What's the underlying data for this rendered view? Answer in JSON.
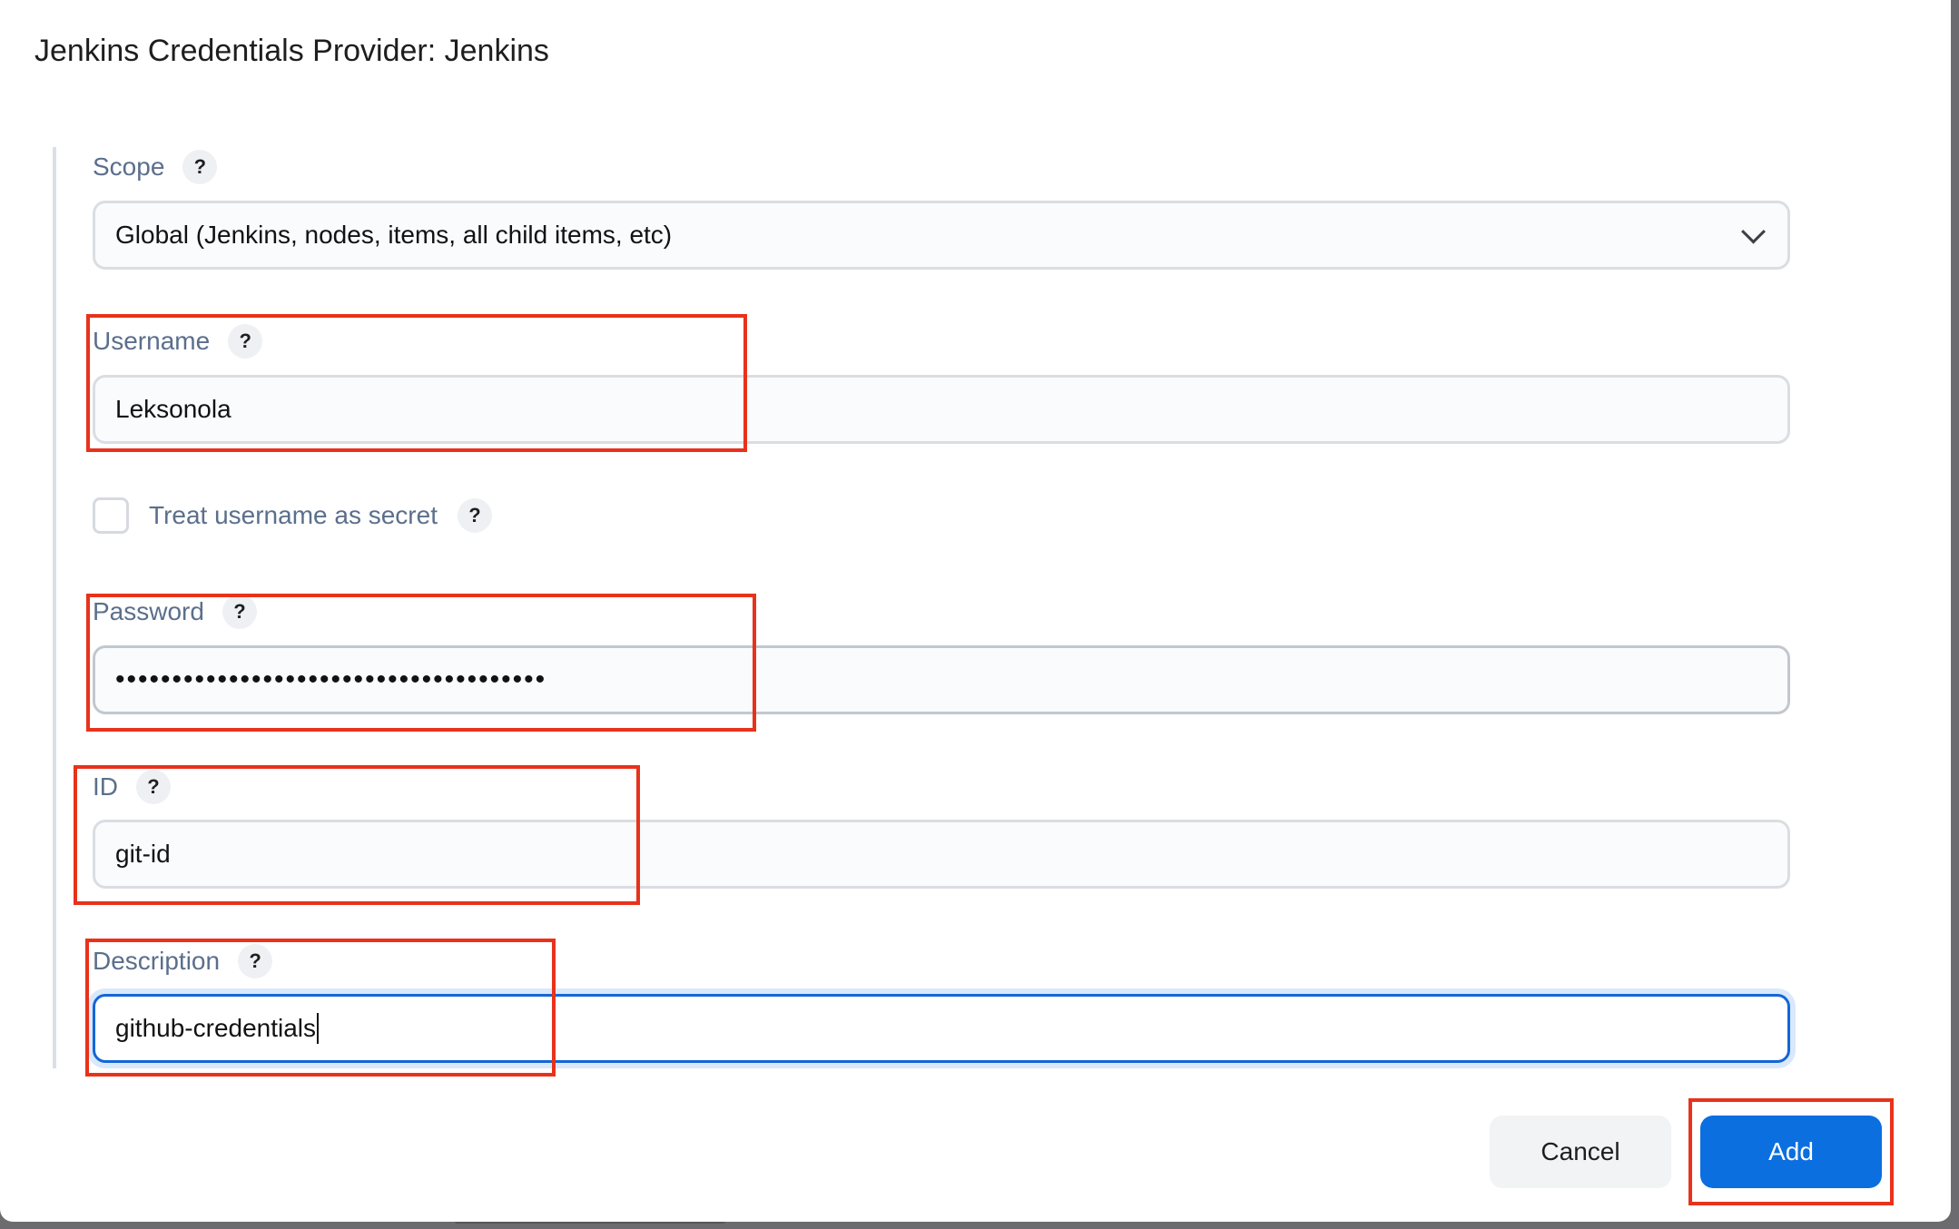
{
  "dialog": {
    "title": "Jenkins Credentials Provider: Jenkins"
  },
  "form": {
    "scope": {
      "label": "Scope",
      "value": "Global (Jenkins, nodes, items, all child items, etc)"
    },
    "username": {
      "label": "Username",
      "value": "Leksonola"
    },
    "treat_username_as_secret": {
      "label": "Treat username as secret",
      "checked": false
    },
    "password": {
      "label": "Password",
      "masked_value": "••••••••••••••••••••••••••••••••••••••"
    },
    "id": {
      "label": "ID",
      "value": "git-id"
    },
    "description": {
      "label": "Description",
      "value": "github-credentials"
    },
    "help_icon_glyph": "?"
  },
  "actions": {
    "cancel_label": "Cancel",
    "add_label": "Add"
  },
  "colors": {
    "label": "#5b6f8c",
    "primary_button": "#0b6fe0",
    "annotation_border": "#e8321b",
    "focus_border": "#1466d6"
  }
}
